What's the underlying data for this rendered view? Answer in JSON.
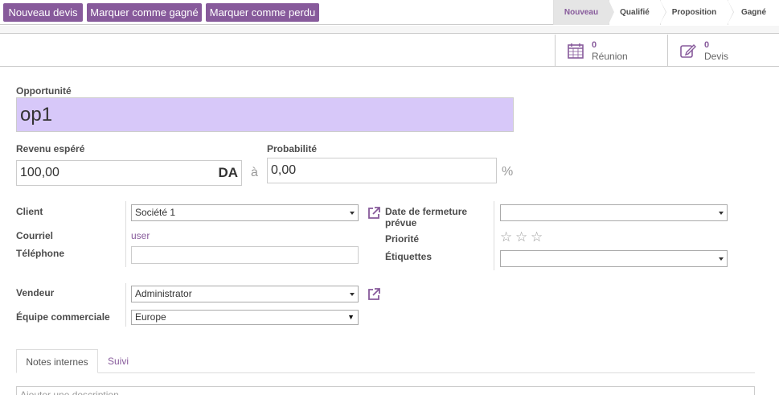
{
  "header": {
    "buttons": {
      "new_quote": "Nouveau devis",
      "mark_won": "Marquer comme gagné",
      "mark_lost": "Marquer comme perdu"
    },
    "stages": [
      "Nouveau",
      "Qualifié",
      "Proposition",
      "Gagné"
    ],
    "active_stage": "Nouveau"
  },
  "stats": {
    "meeting": {
      "count": "0",
      "label": "Réunion",
      "icon": "calendar-icon"
    },
    "quotes": {
      "count": "0",
      "label": "Devis",
      "icon": "edit-icon"
    }
  },
  "form": {
    "opportunity_label": "Opportunité",
    "opportunity_value": "op1",
    "expected_revenue_label": "Revenu espéré",
    "expected_revenue_value": "100,00",
    "currency": "DA",
    "at": "à",
    "probability_label": "Probabilité",
    "probability_value": "0,00",
    "percent": "%",
    "client_label": "Client",
    "client_value": "Société 1",
    "email_label": "Courriel",
    "email_value": "user",
    "phone_label": "Téléphone",
    "phone_value": "",
    "closing_date_label_1": "Date de fermeture",
    "closing_date_label_2": "prévue",
    "closing_date_value": "",
    "priority_label": "Priorité",
    "priority_stars": 0,
    "tags_label": "Étiquettes",
    "tags_value": "",
    "salesperson_label": "Vendeur",
    "salesperson_value": "Administrator",
    "team_label": "Équipe commerciale",
    "team_value": "Europe"
  },
  "tabs": {
    "internal_notes": "Notes internes",
    "follow_up": "Suivi"
  },
  "notes": {
    "placeholder": "Ajouter une description..."
  },
  "colors": {
    "brand": "#875a9b",
    "required_field": "#d7c8f9"
  }
}
